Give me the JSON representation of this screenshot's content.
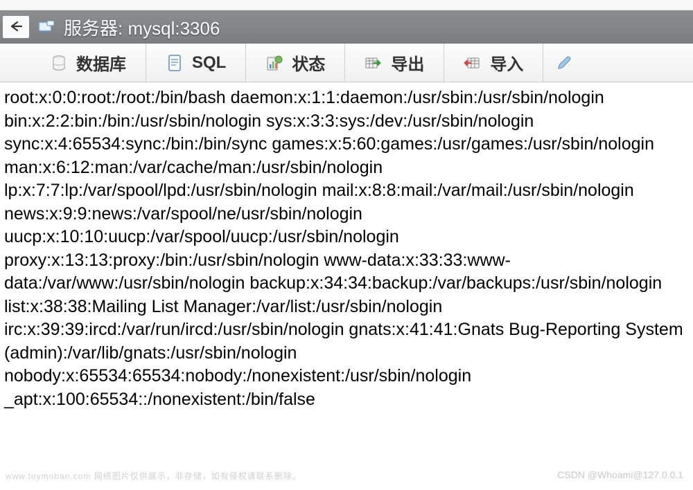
{
  "titlebar": {
    "title": "服务器: mysql:3306"
  },
  "toolbar": {
    "database_label": "数据库",
    "sql_label": "SQL",
    "status_label": "状态",
    "export_label": "导出",
    "import_label": "导入"
  },
  "content": {
    "text": "root:x:0:0:root:/root:/bin/bash daemon:x:1:1:daemon:/usr/sbin:/usr/sbin/nologin bin:x:2:2:bin:/bin:/usr/sbin/nologin sys:x:3:3:sys:/dev:/usr/sbin/nologin sync:x:4:65534:sync:/bin:/bin/sync games:x:5:60:games:/usr/games:/usr/sbin/nologin man:x:6:12:man:/var/cache/man:/usr/sbin/nologin lp:x:7:7:lp:/var/spool/lpd:/usr/sbin/nologin mail:x:8:8:mail:/var/mail:/usr/sbin/nologin news:x:9:9:news:/var/spool/ne/usr/sbin/nologin uucp:x:10:10:uucp:/var/spool/uucp:/usr/sbin/nologin proxy:x:13:13:proxy:/bin:/usr/sbin/nologin www-data:x:33:33:www-data:/var/www:/usr/sbin/nologin backup:x:34:34:backup:/var/backups:/usr/sbin/nologin list:x:38:38:Mailing List Manager:/var/list:/usr/sbin/nologin irc:x:39:39:ircd:/var/run/ircd:/usr/sbin/nologin gnats:x:41:41:Gnats Bug-Reporting System (admin):/var/lib/gnats:/usr/sbin/nologin nobody:x:65534:65534:nobody:/nonexistent:/usr/sbin/nologin _apt:x:100:65534::/nonexistent:/bin/false"
  },
  "watermark": {
    "left": "www.toymoban.com 网络图片仅供展示，非存储，如有侵权请联系删除。",
    "right": "CSDN @Whoami@127.0.0.1"
  }
}
